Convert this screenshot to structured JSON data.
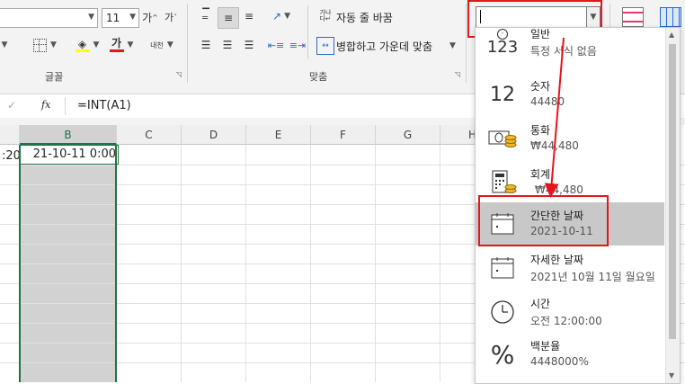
{
  "ribbon": {
    "font_size": "11",
    "grow_font": "가",
    "shrink_font": "가",
    "font_color_glyph": "가",
    "phonetic_glyph": "내천",
    "wrap_text": "자동 줄 바꿈",
    "merge_center": "병합하고 가운데 맞춤",
    "groups": {
      "font": "글꼴",
      "alignment": "맞춤"
    },
    "number_format_value": ""
  },
  "formula_bar": {
    "cancel": "✓",
    "fx": "fx",
    "formula": "=INT(A1)"
  },
  "grid": {
    "columns": [
      "B",
      "C",
      "D",
      "E",
      "F",
      "G",
      "H"
    ],
    "a1_partial": ":20",
    "b1": "21-10-11 0:00"
  },
  "format_menu": {
    "items": [
      {
        "icon": "clock-123-icon",
        "glyph": "123",
        "label": "일반",
        "value": "특정 서식 없음"
      },
      {
        "icon": "number-12-icon",
        "glyph": "12",
        "label": "숫자",
        "value": "44480"
      },
      {
        "icon": "currency-icon",
        "glyph": "",
        "label": "통화",
        "value": "₩44,480"
      },
      {
        "icon": "accounting-icon",
        "glyph": "",
        "label": "회계",
        "value": "₩44,480"
      },
      {
        "icon": "calendar-short-icon",
        "glyph": "",
        "label": "간단한 날짜",
        "value": "2021-10-11"
      },
      {
        "icon": "calendar-long-icon",
        "glyph": "",
        "label": "자세한 날짜",
        "value": "2021년 10월 11일 월요일"
      },
      {
        "icon": "clock-icon",
        "glyph": "",
        "label": "시간",
        "value": "오전 12:00:00"
      },
      {
        "icon": "percent-icon",
        "glyph": "%",
        "label": "백분율",
        "value": "4448000%"
      }
    ]
  },
  "colors": {
    "highlight_red": "#e8141b",
    "selected_col": "#d2d2d2",
    "cell_border": "#217346"
  }
}
